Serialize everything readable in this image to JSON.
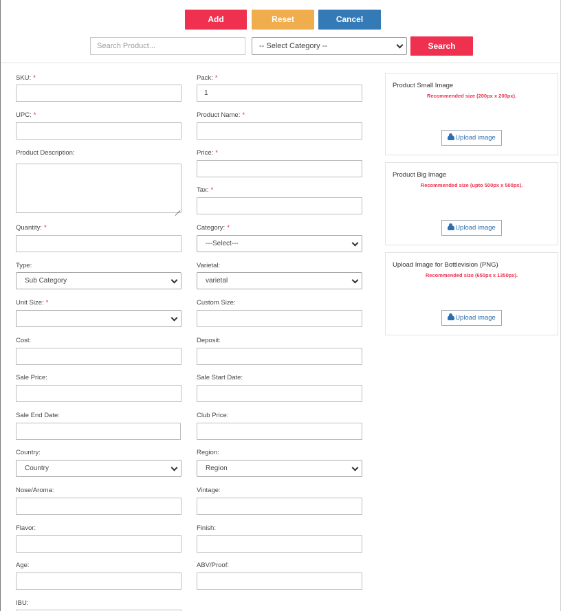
{
  "toolbar": {
    "add_label": "Add",
    "reset_label": "Reset",
    "cancel_label": "Cancel",
    "search_label": "Search",
    "search_placeholder": "Search Product...",
    "category_selected": "-- Select Category --"
  },
  "form": {
    "sku_label": "SKU:",
    "pack_label": "Pack:",
    "pack_value": "1",
    "upc_label": "UPC:",
    "product_name_label": "Product Name:",
    "product_description_label": "Product Description:",
    "price_label": "Price:",
    "tax_label": "Tax:",
    "quantity_label": "Quantity:",
    "category_label": "Category:",
    "category_selected": "---Select---",
    "type_label": "Type:",
    "type_selected": "Sub Category",
    "varietal_label": "Varietal:",
    "varietal_selected": "varietal",
    "unit_size_label": "Unit Size:",
    "unit_size_selected": "",
    "custom_size_label": "Custom Size:",
    "cost_label": "Cost:",
    "deposit_label": "Deposit:",
    "sale_price_label": "Sale Price:",
    "sale_start_date_label": "Sale Start Date:",
    "sale_end_date_label": "Sale End Date:",
    "club_price_label": "Club Price:",
    "country_label": "Country:",
    "country_selected": "Country",
    "region_label": "Region:",
    "region_selected": "Region",
    "nose_aroma_label": "Nose/Aroma:",
    "vintage_label": "Vintage:",
    "flavor_label": "Flavor:",
    "finish_label": "Finish:",
    "age_label": "Age:",
    "abv_proof_label": "ABV/Proof:",
    "ibu_label": "IBU:",
    "required_mark": "*"
  },
  "images": {
    "small": {
      "title": "Product Small Image",
      "note": "Recommended size (200px x 200px).",
      "upload_label": "Upload image"
    },
    "big": {
      "title": "Product Big Image",
      "note": "Recommended size (upto 500px x 500px).",
      "upload_label": "Upload image"
    },
    "bottlevision": {
      "title": "Upload Image for Bottlevision (PNG)",
      "note": "Recommended size (650px x 1350px).",
      "upload_label": "Upload image"
    }
  },
  "colors": {
    "primary_red": "#f0304f",
    "warning_orange": "#f0ad4e",
    "info_blue": "#337ab7",
    "required_red": "#e02545"
  }
}
